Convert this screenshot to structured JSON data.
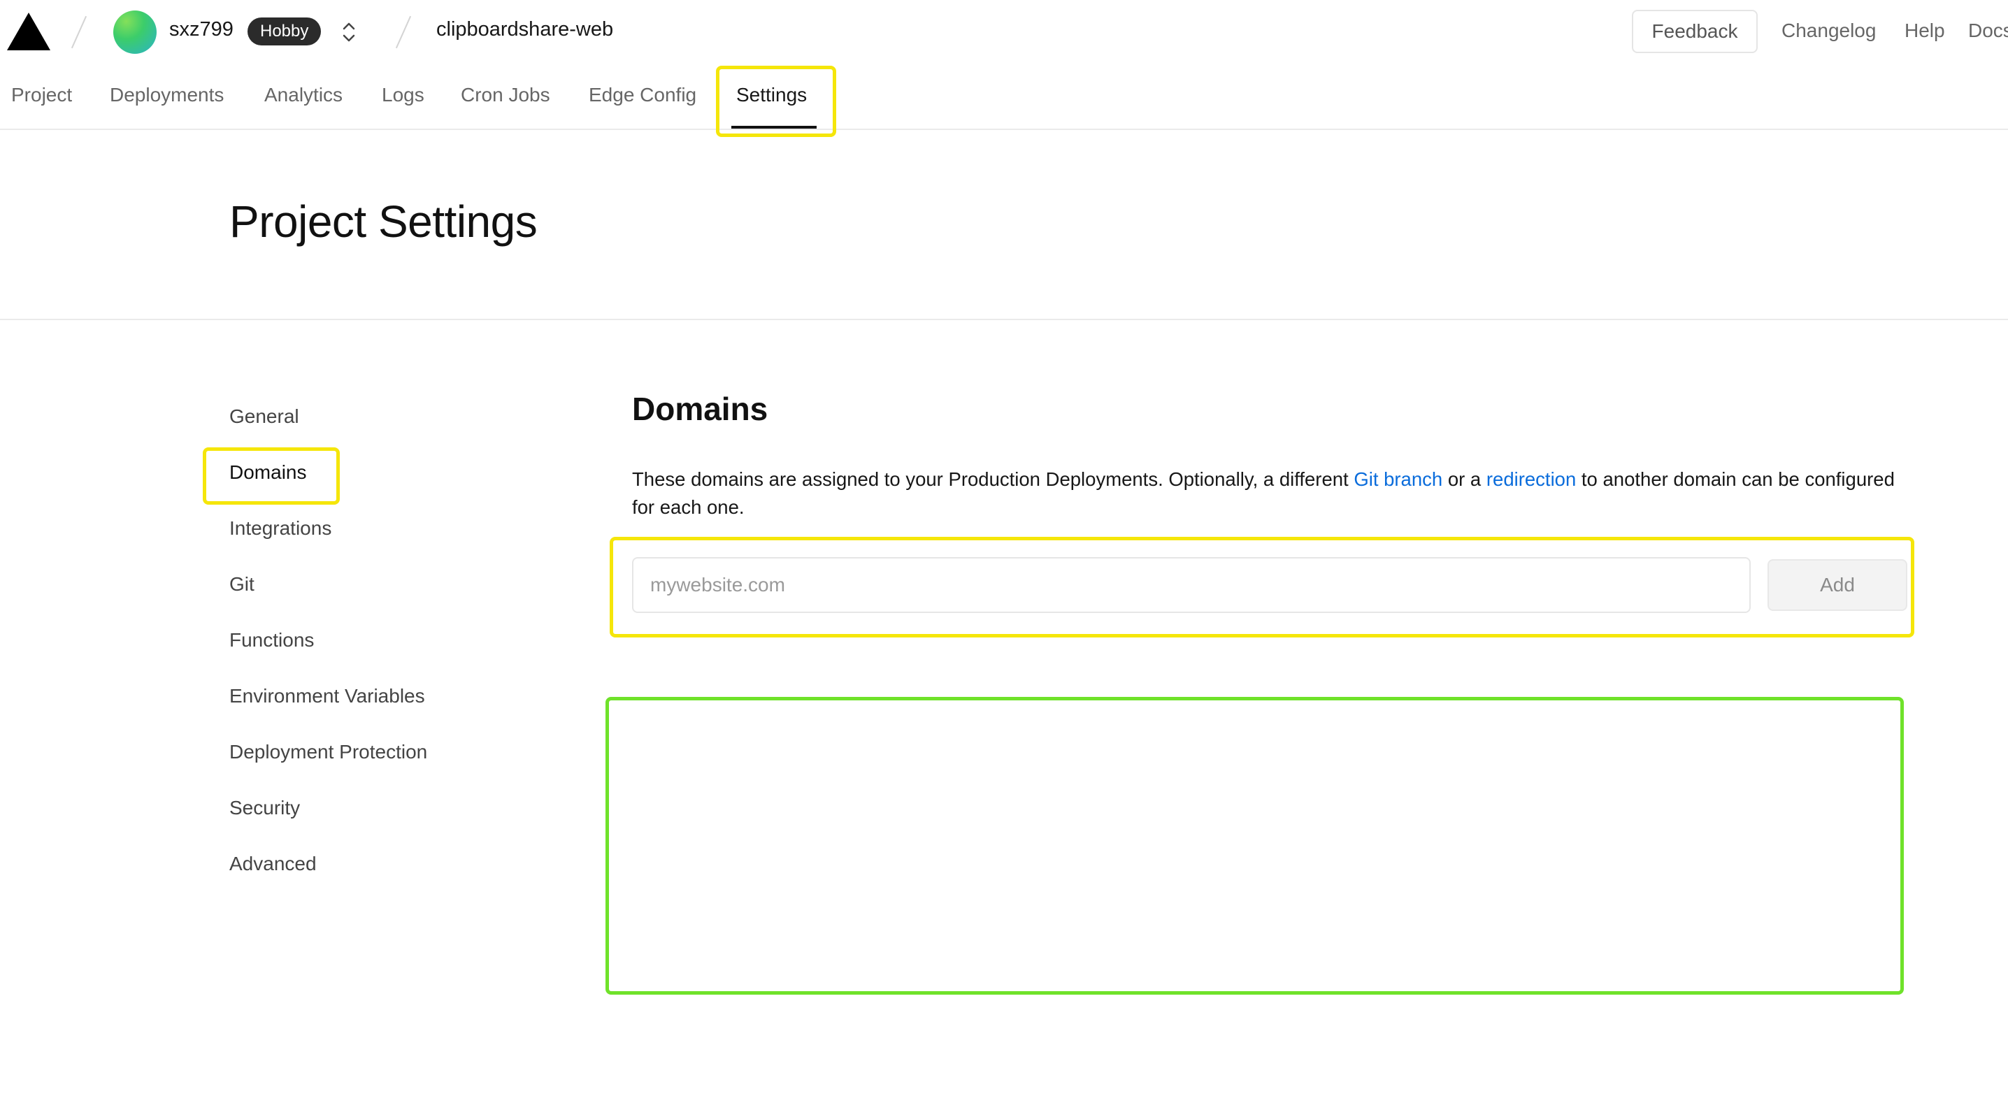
{
  "header": {
    "team_name": "sxz799",
    "plan_badge": "Hobby",
    "project_name": "clipboardshare-web",
    "feedback_label": "Feedback",
    "links": [
      "Changelog",
      "Help",
      "Docs"
    ]
  },
  "tabs": [
    "Project",
    "Deployments",
    "Analytics",
    "Logs",
    "Cron Jobs",
    "Edge Config",
    "Settings"
  ],
  "active_tab": "Settings",
  "page_title": "Project Settings",
  "sidebar": {
    "items": [
      "General",
      "Domains",
      "Integrations",
      "Git",
      "Functions",
      "Environment Variables",
      "Deployment Protection",
      "Security",
      "Advanced"
    ],
    "active": "Domains"
  },
  "domains": {
    "title": "Domains",
    "description_parts": [
      "These domains are assigned to your Production Deployments. Optionally, a different ",
      "Git branch",
      " or a ",
      "redirection",
      " to another domain can be configured for each one."
    ],
    "input_value": "",
    "input_placeholder": "mywebsite.com",
    "add_label": "Add"
  },
  "colors": {
    "link": "#0a6cdb",
    "highlight_yellow": "#f5e60a",
    "highlight_green": "#6fe22a",
    "badge_bg": "#2b2b2b"
  },
  "icons": {
    "logo": "vercel-triangle-icon",
    "switcher": "chevron-up-down-icon"
  }
}
